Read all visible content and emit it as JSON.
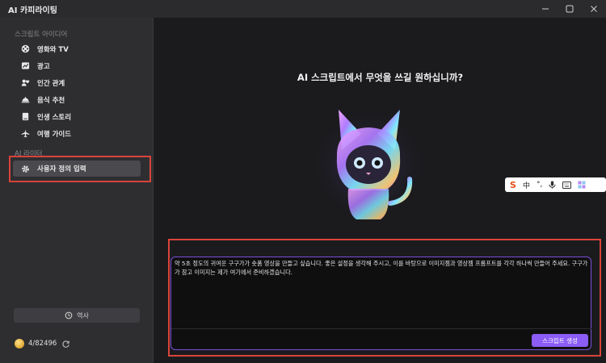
{
  "app": {
    "title": "AI 카피라이팅",
    "window_controls": {
      "minimize": "—",
      "maximize": "☐",
      "close": "✕"
    }
  },
  "sidebar": {
    "section1_label": "스크립트 아이디어",
    "items": [
      {
        "label": "영화와 TV",
        "icon": "film-reel-icon"
      },
      {
        "label": "광고",
        "icon": "chart-icon"
      },
      {
        "label": "인간 관계",
        "icon": "heart-people-icon"
      },
      {
        "label": "음식 추천",
        "icon": "food-cloche-icon"
      },
      {
        "label": "인생 스토리",
        "icon": "book-icon"
      },
      {
        "label": "여행 가이드",
        "icon": "airplane-icon"
      }
    ],
    "section2_label": "AI 라이터",
    "custom_item": {
      "label": "사용자 정의 입력",
      "icon": "gear-icon"
    },
    "history_label": "역사",
    "credits": "4/82496"
  },
  "main": {
    "headline": "AI 스크립트에서 무엇을 쓰길 원하십니까?",
    "prompt_text": "약 5초 정도의 귀여운 구구가가 숏폼 영상을 만들고 싶습니다. 좋은 설정을 생각해 주시고, 이를 바탕으로 이미지젬과 영상젬 프롬프트를 각각 하나씩 만들어 주세요. 구구가가 참고 이미지는 제가 여기에서 준비하겠습니다.",
    "generate_label": "스크립트 생성"
  },
  "ime_toolbar": {
    "items": [
      "S",
      "中",
      "°,",
      "mic",
      "keyboard",
      "grid"
    ]
  },
  "colors": {
    "accent": "#8b5cf6",
    "highlight_box": "#d9443a"
  }
}
